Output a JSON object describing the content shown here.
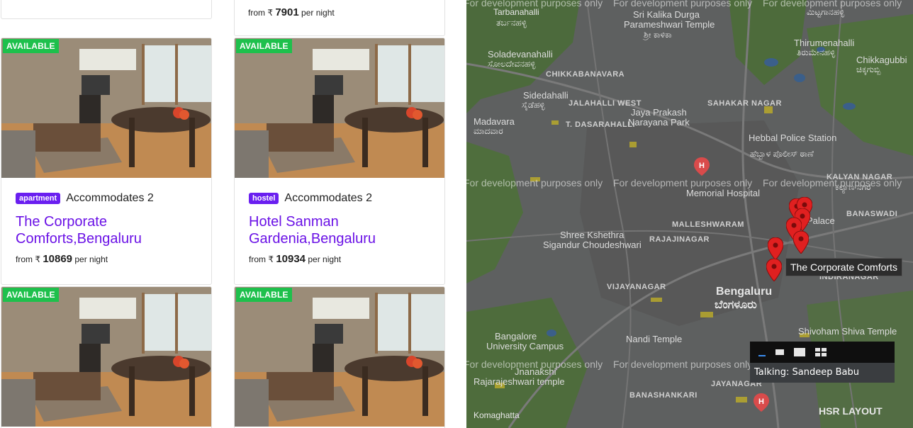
{
  "top_partial": {
    "price_prefix": "from ₹",
    "price_amount": "7901",
    "price_suffix": "per night"
  },
  "listings": [
    {
      "available_label": "AVAILABLE",
      "type": "apartment",
      "accommodates": "Accommodates 2",
      "title": "The Corporate Comforts,Bengaluru",
      "price_prefix": "from ₹",
      "price_amount": "10869",
      "price_suffix": "per night"
    },
    {
      "available_label": "AVAILABLE",
      "type": "hostel",
      "accommodates": "Accommodates 2",
      "title": "Hotel Sanman Gardenia,Bengaluru",
      "price_prefix": "from ₹",
      "price_amount": "10934",
      "price_suffix": "per night"
    },
    {
      "available_label": "AVAILABLE"
    },
    {
      "available_label": "AVAILABLE"
    }
  ],
  "map": {
    "watermark": "For development purposes only",
    "labels": {
      "tarbanahalli": "Tarbanahalli",
      "tarbanahalli_kn": "ತರ್ಬನಹಳ್ಳಿ",
      "kalika": "Sri Kalika Durga",
      "parameshwari": "Parameshwari Temple",
      "kalika_kn": "ಶ್ರೀ ಕಾಳಿಕಾ",
      "mittaganahalli_kn": "ಮಿಟ್ಟಗಾನಹಳ್ಳಿ",
      "soladevanahalli": "Soladevanahalli",
      "soladevanahalli_kn": "ಸೋಲದೇವನಹಳ್ಳಿ",
      "thirumenahalli": "Thirumenahalli",
      "thirumenahalli_kn": "ತಿರುಮೇನಹಳ್ಳಿ",
      "chikkagubbi": "Chikkagubbi",
      "chikkagubbi_kn": "ಚಿಕ್ಕಗುಬ್ಬಿ",
      "chikkabanavara": "CHIKKABANAVARA",
      "sidedahalli": "Sidedahalli",
      "sidedahalli_kn": "ಸೈಡೆಹಳ್ಳಿ",
      "jalahalli_west": "JALAHALLI WEST",
      "jaya_prakash": "Jaya Prakash",
      "narayana_park": "Narayana Park",
      "sahakar_nagar": "SAHAKAR NAGAR",
      "madavara": "Madavara",
      "madavara_kn": "ಮಾದವಾರ",
      "t_dasarahalli": "T. DASARAHALLI",
      "hebbal": "Hebbal Police Station",
      "hebbal_kn": "ಹೆಬ್ಬಾಳ ಪೊಲೀಸ್ ಠಾಣೆ",
      "kalyan_nagar": "KALYAN NAGAR",
      "kalyan_nagar_kn": "ಕಲ್ಯಾಣ ನಗರ",
      "memorial": "Memorial Hospital",
      "banaswadi": "BANASWADI",
      "shree_kshethra": "Shree Kshethra",
      "sigandur": "Sigandur Choudeshwari",
      "rajajinagar": "RAJAJINAGAR",
      "malleshwaram": "MALLESHWARAM",
      "palace": "Palace",
      "vijayanagar": "VIJAYANAGAR",
      "bengaluru": "Bengaluru",
      "bengaluru_kn": "ಬೆಂಗಳೂರು",
      "indiranagar": "INDIRANAGAR",
      "shivoham": "Shivoham Shiva Temple",
      "bangalore_univ": "Bangalore",
      "univ_campus": "University Campus",
      "nandi": "Nandi Temple",
      "jnanakshi": "Jnanakshi",
      "rajarajeshwari": "Rajarajeshwari temple",
      "banashankari": "BANASHANKARI",
      "jayanagar": "JAYANAGAR",
      "hsr_layout": "HSR LAYOUT",
      "komaghatta": "Komaghatta"
    },
    "tooltip": "The Corporate Comforts",
    "talking": "Talking: Sandeep Babu"
  }
}
